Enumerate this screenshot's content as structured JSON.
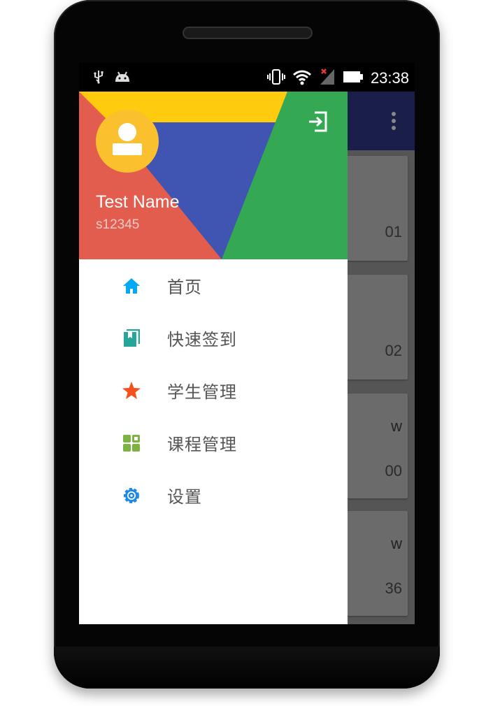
{
  "statusbar": {
    "time": "23:38",
    "icons": [
      "usb-icon",
      "android-icon",
      "vibrate-icon",
      "wifi-icon",
      "signal-icon",
      "battery-icon"
    ]
  },
  "drawer": {
    "user": {
      "name": "Test Name",
      "id": "s12345"
    },
    "menu": [
      {
        "label": "首页",
        "icon": "home-icon",
        "color": "#03a9f4"
      },
      {
        "label": "快速签到",
        "icon": "book-icon",
        "color": "#26a69a"
      },
      {
        "label": "学生管理",
        "icon": "star-icon",
        "color": "#f4511e"
      },
      {
        "label": "课程管理",
        "icon": "grid-icon",
        "color": "#7cb342"
      },
      {
        "label": "设置",
        "icon": "settings-icon",
        "color": "#1e88e5"
      }
    ]
  },
  "background_cards": [
    {
      "title": "",
      "text": "01"
    },
    {
      "title": "",
      "text": "02"
    },
    {
      "title": "w",
      "text": "00"
    },
    {
      "title": "w",
      "text": "36"
    }
  ],
  "colors": {
    "header_red": "#e35d4f",
    "header_yellow": "#fecb0e",
    "header_blue": "#3f55b1",
    "header_green": "#34a853",
    "appbar": "#1a1f4a"
  }
}
